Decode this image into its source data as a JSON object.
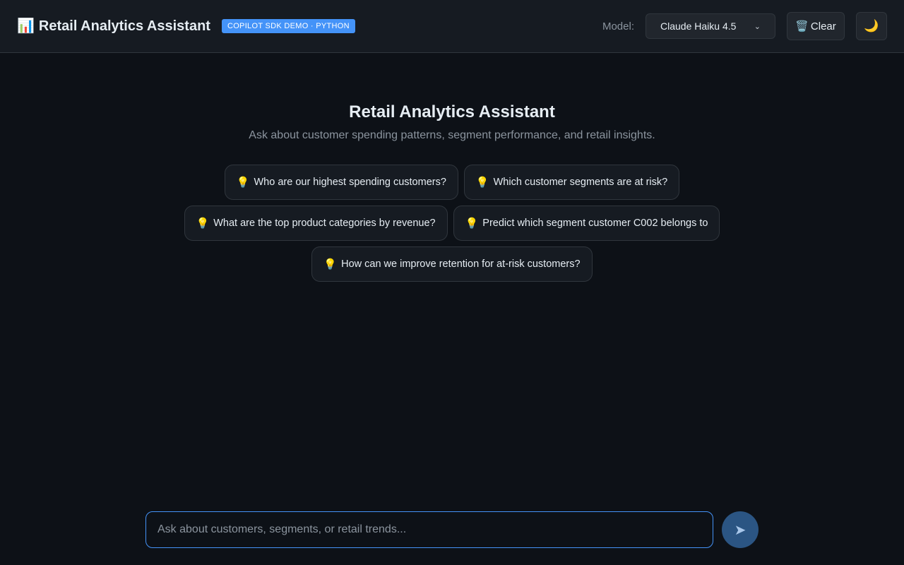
{
  "header": {
    "icon": "bar-chart-icon",
    "title": "Retail Analytics Assistant",
    "badge": "COPILOT SDK DEMO · PYTHON",
    "model_label": "Model:",
    "model_selected": "Claude Haiku 4.5",
    "clear_icon": "wastebasket-icon",
    "clear_label": "Clear",
    "theme_icon": "moon-icon"
  },
  "hero": {
    "title": "Retail Analytics Assistant",
    "subtitle": "Ask about customer spending patterns, segment performance, and retail insights."
  },
  "suggestions": [
    "Who are our highest spending customers?",
    "Which customer segments are at risk?",
    "What are the top product categories by revenue?",
    "Predict which segment customer C002 belongs to",
    "How can we improve retention for at-risk customers?"
  ],
  "composer": {
    "placeholder": "Ask about customers, segments, or retail trends...",
    "send_icon": "send-arrow-icon"
  },
  "colors": {
    "background": "#0d1117",
    "header": "#161b22",
    "accent": "#4493f8",
    "send_button": "#2b5583"
  }
}
